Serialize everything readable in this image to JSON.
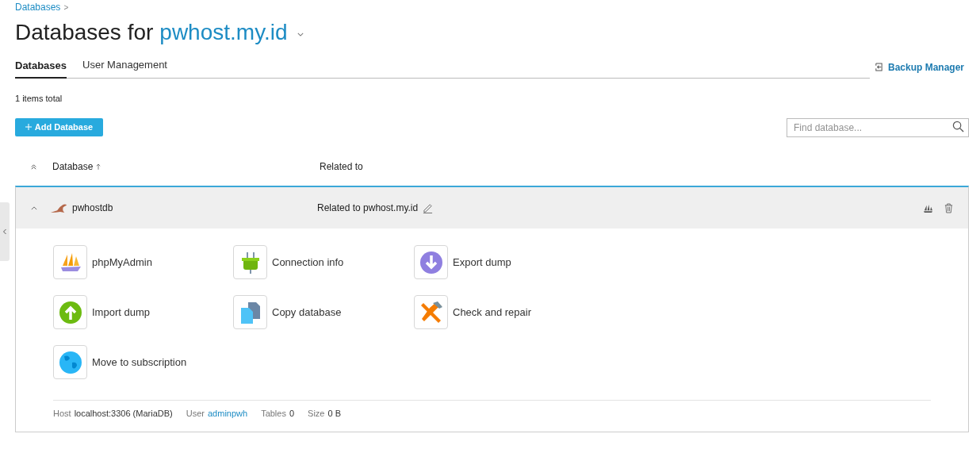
{
  "breadcrumb": {
    "label": "Databases",
    "separator": ">"
  },
  "title": {
    "prefix": "Databases for",
    "domain": "pwhost.my.id"
  },
  "tabs": [
    {
      "label": "Databases",
      "selected": true
    },
    {
      "label": "User Management",
      "selected": false
    }
  ],
  "backup_link": "Backup Manager",
  "items_total": "1 items total",
  "add_button": "Add Database",
  "search": {
    "placeholder": "Find database..."
  },
  "columns": [
    {
      "label": "Database",
      "sorted": true
    },
    {
      "label": "Related to",
      "sorted": false
    }
  ],
  "rows": [
    {
      "name": "pwhostdb",
      "related": "Related to pwhost.my.id",
      "expanded": true,
      "actions": [
        {
          "label": "phpMyAdmin",
          "kind": "sailboat"
        },
        {
          "label": "Connection info",
          "kind": "plug"
        },
        {
          "label": "Export dump",
          "kind": "export"
        },
        {
          "label": "Import dump",
          "kind": "import"
        },
        {
          "label": "Copy database",
          "kind": "copy"
        },
        {
          "label": "Check and repair",
          "kind": "tools"
        },
        {
          "label": "Move to subscription",
          "kind": "globe"
        }
      ],
      "footer": [
        {
          "label": "Host",
          "value": "localhost:3306 (MariaDB)",
          "kind": "text"
        },
        {
          "label": "User",
          "value": "adminpwh",
          "kind": "link"
        },
        {
          "label": "Tables",
          "value": "0",
          "kind": "text"
        },
        {
          "label": "Size",
          "value": "0 B",
          "kind": "text"
        }
      ]
    }
  ]
}
